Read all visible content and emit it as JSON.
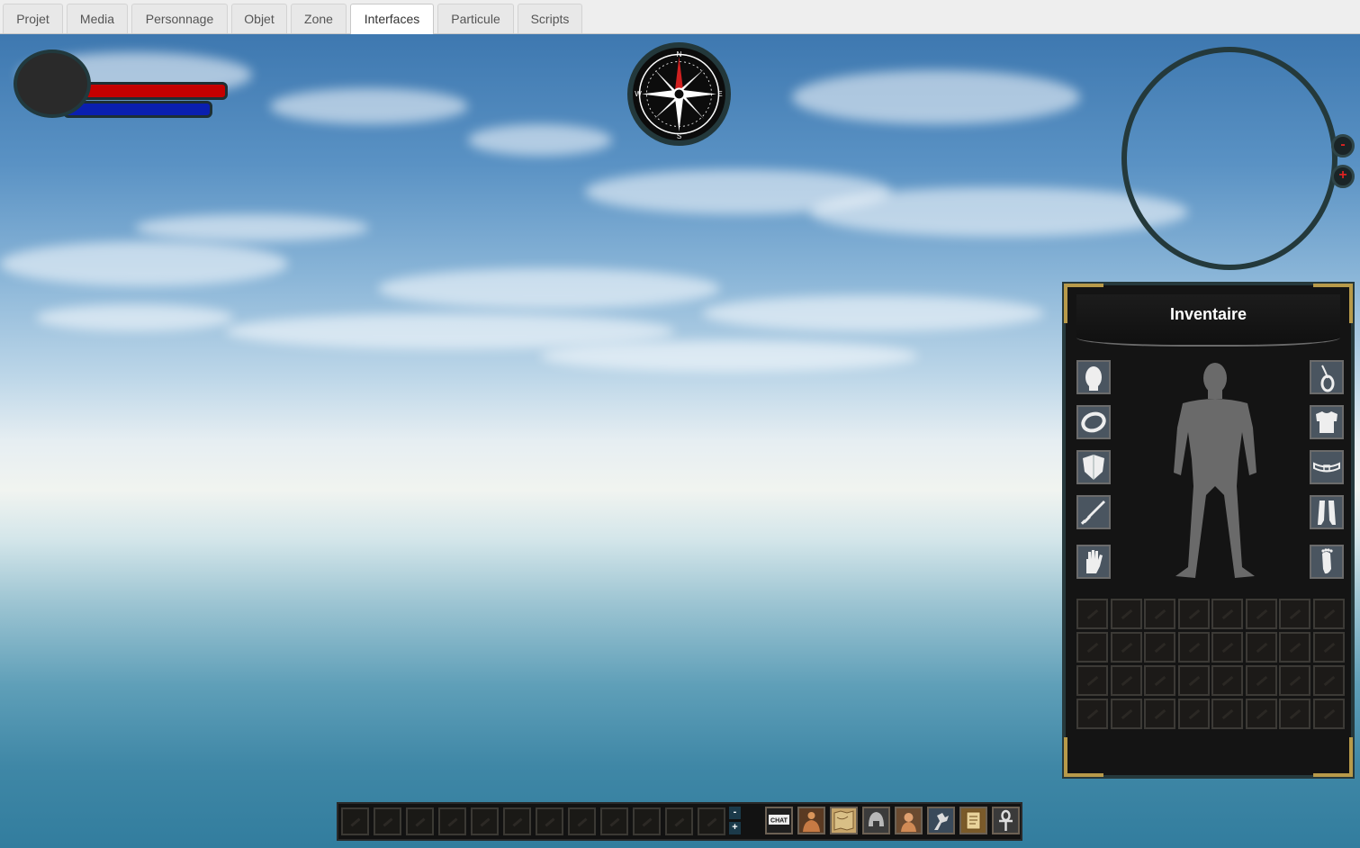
{
  "tabs": [
    {
      "label": "Projet",
      "active": false
    },
    {
      "label": "Media",
      "active": false
    },
    {
      "label": "Personnage",
      "active": false
    },
    {
      "label": "Objet",
      "active": false
    },
    {
      "label": "Zone",
      "active": false
    },
    {
      "label": "Interfaces",
      "active": true
    },
    {
      "label": "Particule",
      "active": false
    },
    {
      "label": "Scripts",
      "active": false
    }
  ],
  "compass": {
    "north": "N",
    "south": "S",
    "east": "E",
    "west": "W"
  },
  "minimap": {
    "zoom_out_label": "-",
    "zoom_in_label": "+"
  },
  "player": {
    "health_fill": 1.0,
    "mana_fill": 1.0,
    "health_color": "#c40000",
    "mana_color": "#0a1fb0"
  },
  "inventory": {
    "title": "Inventaire",
    "equipment_left": [
      "head-slot-icon",
      "ring-slot-icon",
      "shield-slot-icon",
      "sword-slot-icon",
      "glove-slot-icon"
    ],
    "equipment_right": [
      "amulet-slot-icon",
      "chest-slot-icon",
      "belt-slot-icon",
      "legs-slot-icon",
      "feet-slot-icon"
    ],
    "grid_rows": 4,
    "grid_cols": 8
  },
  "hotbar": {
    "slot_count": 12,
    "minus_label": "-",
    "plus_label": "+",
    "chat_label": "CHAT",
    "menu_buttons": [
      "chat-button-icon",
      "character-button-icon",
      "map-button-icon",
      "helmet-button-icon",
      "portrait-button-icon",
      "skills-button-icon",
      "quest-scroll-button-icon",
      "ankh-button-icon"
    ]
  }
}
